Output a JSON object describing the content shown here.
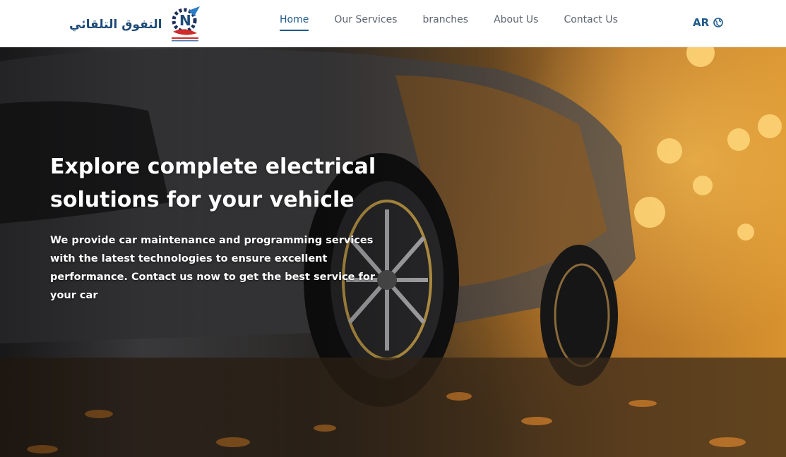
{
  "header": {
    "brand_name": "التفوق التلقائي",
    "nav": [
      {
        "label": "Home",
        "active": true
      },
      {
        "label": "Our Services",
        "active": false
      },
      {
        "label": "branches",
        "active": false
      },
      {
        "label": "About Us",
        "active": false
      },
      {
        "label": "Contact Us",
        "active": false
      }
    ],
    "language_label": "AR",
    "language_icon": "globe-icon"
  },
  "hero": {
    "title": "Explore complete electrical solutions for your vehicle",
    "description": "We provide car maintenance and programming services with the latest technologies to ensure excellent performance. Contact us now to get the best service for your car",
    "background": "car-wheel-street-photo"
  },
  "colors": {
    "accent": "#1f5a8c",
    "nav_text": "#5a6470",
    "brand_text": "#1d4a78",
    "hero_text": "#ffffff"
  }
}
